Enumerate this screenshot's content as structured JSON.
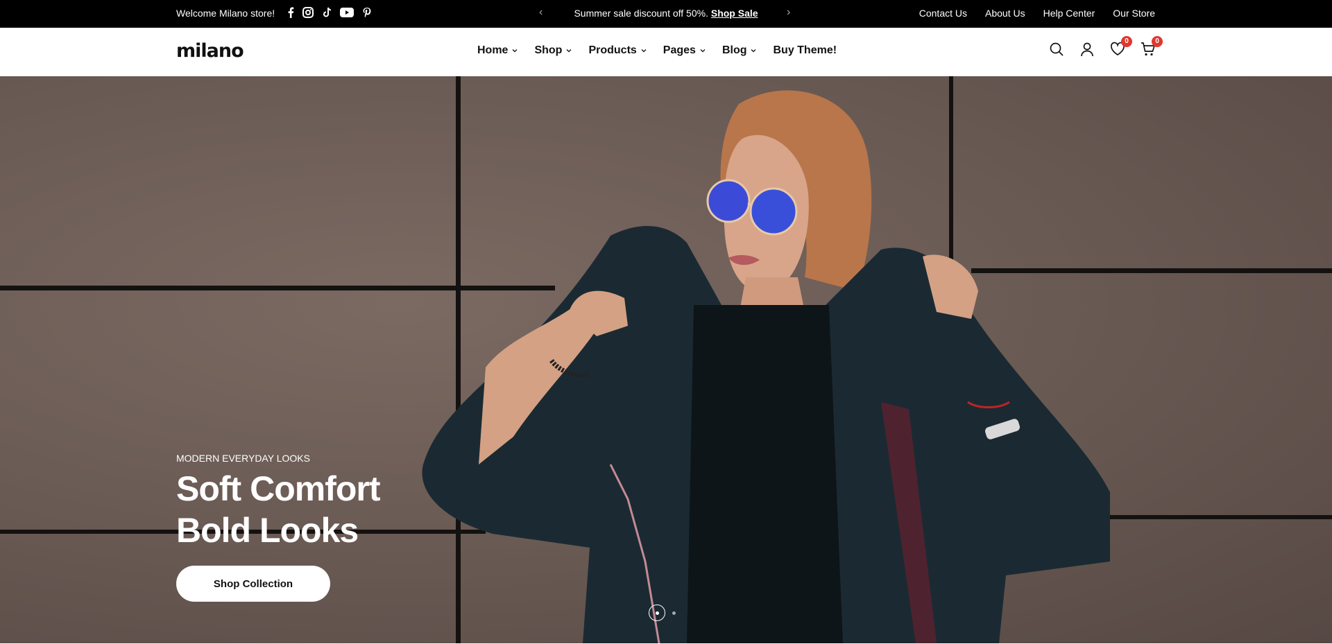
{
  "topbar": {
    "welcome": "Welcome Milano store!",
    "socials": [
      "facebook-icon",
      "instagram-icon",
      "tiktok-icon",
      "youtube-icon",
      "pinterest-icon"
    ],
    "promo_text": "Summer sale discount off 50%.",
    "promo_link": "Shop Sale",
    "links": [
      "Contact Us",
      "About Us",
      "Help Center",
      "Our Store"
    ]
  },
  "header": {
    "logo": "milano",
    "nav": [
      {
        "label": "Home",
        "has_dropdown": true
      },
      {
        "label": "Shop",
        "has_dropdown": true
      },
      {
        "label": "Products",
        "has_dropdown": true
      },
      {
        "label": "Pages",
        "has_dropdown": true
      },
      {
        "label": "Blog",
        "has_dropdown": true
      },
      {
        "label": "Buy Theme!",
        "has_dropdown": false
      }
    ],
    "wishlist_count": "0",
    "cart_count": "0"
  },
  "hero": {
    "subtitle": "MODERN EVERYDAY LOOKS",
    "title_line1": "Soft Comfort",
    "title_line2": "Bold Looks",
    "cta": "Shop Collection",
    "slides": 2,
    "active_slide": 1
  },
  "colors": {
    "topbar_bg": "#000000",
    "badge": "#e0382e",
    "hero_wall": "#6a5a54"
  }
}
